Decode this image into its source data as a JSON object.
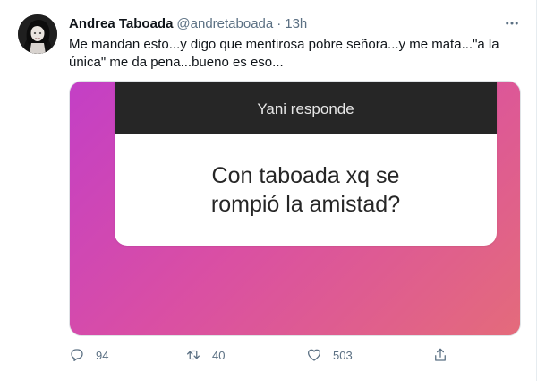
{
  "tweet": {
    "author": {
      "display_name": "Andrea Taboada",
      "handle": "@andretaboada",
      "separator": "·",
      "time": "13h"
    },
    "text": "Me mandan esto...y digo que mentirosa pobre señora...y me mata...\"a la única\" me da pena...bueno es eso...",
    "media": {
      "card_title": "Yani responde",
      "question": "Con taboada xq se rompió la amistad?"
    },
    "actions": {
      "reply_count": "94",
      "retweet_count": "40",
      "like_count": "503"
    }
  },
  "colors": {
    "text_primary": "#0f1419",
    "text_secondary": "#5b7083",
    "gradient_start": "#c33fc6",
    "gradient_end": "#e46b7b",
    "card_header": "#262626"
  },
  "icons": {
    "more": "more-horizontal-icon",
    "reply": "reply-icon",
    "retweet": "retweet-icon",
    "like": "heart-icon",
    "share": "share-icon"
  }
}
